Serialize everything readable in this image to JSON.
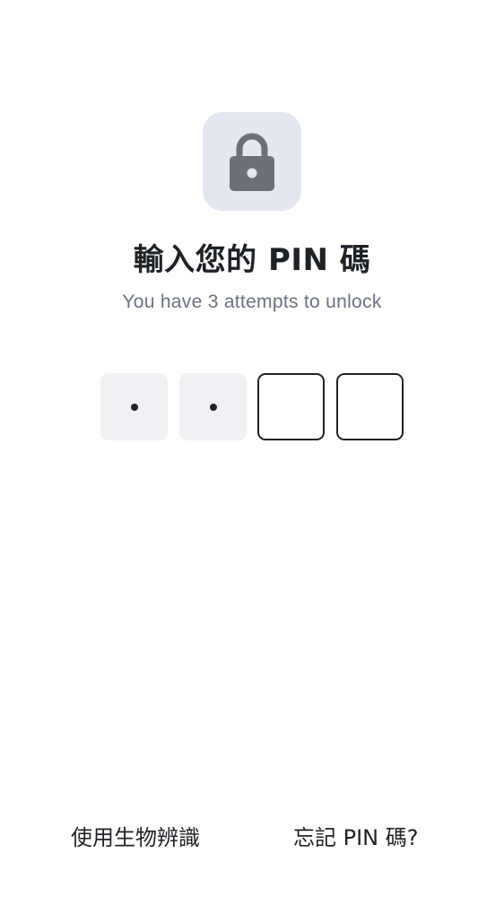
{
  "lock": {
    "icon": "lock-icon",
    "tile_color": "#e3e7f0",
    "icon_color": "#6b7079"
  },
  "title": "輸入您的 PIN 碼",
  "subtitle": "You have 3 attempts to unlock",
  "pin": {
    "length": 4,
    "entered": 2,
    "mask_char": "•"
  },
  "actions": {
    "biometric_label": "使用生物辨識",
    "forgot_label": "忘記 PIN 碼?"
  }
}
